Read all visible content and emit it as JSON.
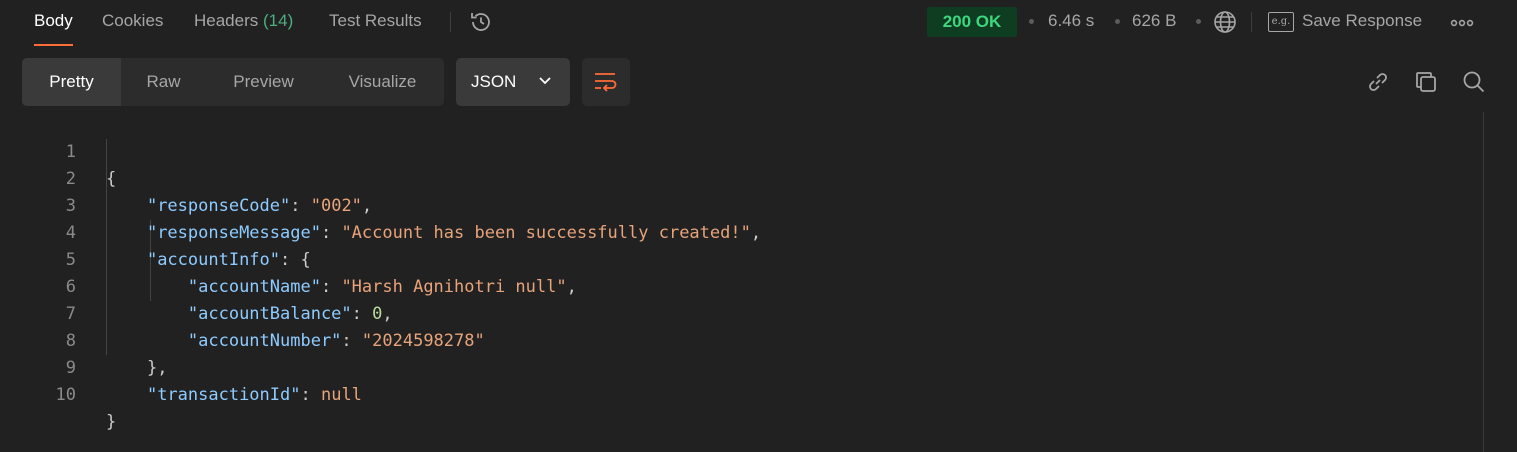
{
  "tabs": {
    "body": "Body",
    "cookies": "Cookies",
    "headers_label": "Headers",
    "headers_count": "(14)",
    "test_results": "Test Results"
  },
  "response": {
    "status": "200 OK",
    "time": "6.46 s",
    "size": "626 B",
    "save_label": "Save Response",
    "eg_label": "e.g."
  },
  "view_modes": {
    "pretty": "Pretty",
    "raw": "Raw",
    "preview": "Preview",
    "visualize": "Visualize"
  },
  "format": {
    "selected": "JSON"
  },
  "colors": {
    "accent": "#ff6c37",
    "status_bg": "#0f3d22",
    "status_text": "#3ed67e",
    "json_key": "#8ecbff",
    "json_string": "#e7a37a",
    "json_number": "#b7dd9a"
  },
  "icons": {
    "history": "history-icon",
    "globe": "globe-icon",
    "more": "more-icon",
    "wrap": "wrap-lines-icon",
    "link": "link-icon",
    "copy": "copy-icon",
    "search": "search-icon"
  },
  "code": {
    "line_numbers": [
      "1",
      "2",
      "3",
      "4",
      "5",
      "6",
      "7",
      "8",
      "9",
      "10"
    ],
    "open_brace": "{",
    "close_brace": "}",
    "k_responseCode": "\"responseCode\"",
    "v_responseCode": "\"002\"",
    "k_responseMessage": "\"responseMessage\"",
    "v_responseMessage": "\"Account has been successfully created!\"",
    "k_accountInfo": "\"accountInfo\"",
    "k_accountName": "\"accountName\"",
    "v_accountName": "\"Harsh Agnihotri null\"",
    "k_accountBalance": "\"accountBalance\"",
    "v_accountBalance": "0",
    "k_accountNumber": "\"accountNumber\"",
    "v_accountNumber": "\"2024598278\"",
    "close_obj_comma": "},",
    "k_transactionId": "\"transactionId\"",
    "v_transactionId": "null"
  }
}
